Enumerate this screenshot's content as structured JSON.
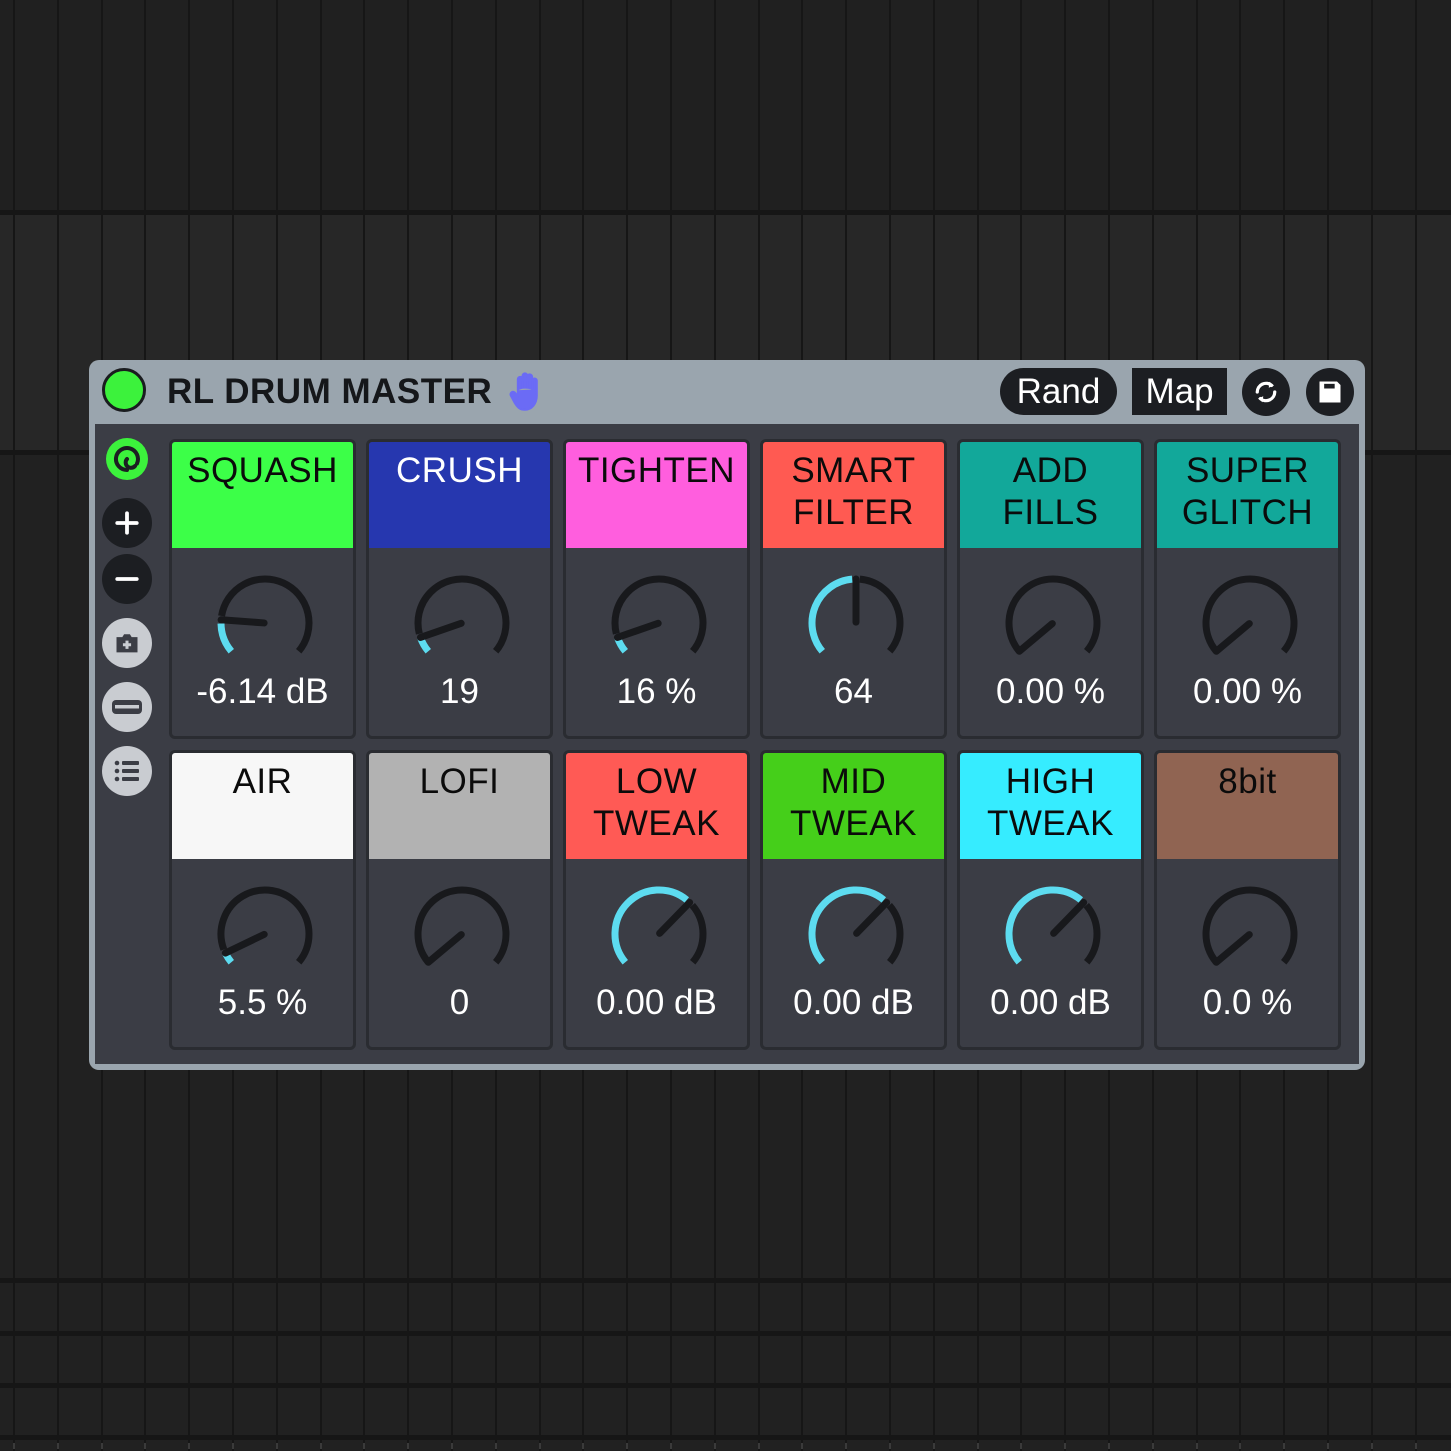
{
  "device": {
    "title": "RL DRUM MASTER",
    "power_on": true,
    "power_color": "#3cf23c",
    "hand_color": "#6b6bf5",
    "buttons": {
      "rand": "Rand",
      "map": "Map"
    },
    "icons": {
      "power": "power-toggle-icon",
      "hand": "hand-icon",
      "refresh": "refresh-icon",
      "save": "floppy-save-icon"
    }
  },
  "sidebar": [
    {
      "name": "macro-variation-toggle",
      "icon": "swirl-icon",
      "style": "active"
    },
    {
      "name": "add-macro",
      "icon": "plus-icon",
      "style": "dark"
    },
    {
      "name": "remove-macro",
      "icon": "minus-icon",
      "style": "dark"
    },
    {
      "name": "snapshot",
      "icon": "camera-plus-icon",
      "style": "light"
    },
    {
      "name": "collapse",
      "icon": "bar-icon",
      "style": "light"
    },
    {
      "name": "list",
      "icon": "list-icon",
      "style": "light"
    }
  ],
  "accent_color": "#5ddcf0",
  "macros": [
    {
      "label": "SQUASH",
      "color": "#3cff48",
      "text_color": "#0b0b0b",
      "value": "-6.14 dB",
      "position": 0.17
    },
    {
      "label": "CRUSH",
      "color": "#2637af",
      "text_color": "#ffffff",
      "value": "19",
      "position": 0.08
    },
    {
      "label": "TIGHTEN",
      "color": "#ff5ede",
      "text_color": "#0b0b0b",
      "value": "16 %",
      "position": 0.08
    },
    {
      "label": "SMART\nFILTER",
      "color": "#ff5a52",
      "text_color": "#0b0b0b",
      "value": "64",
      "position": 0.5
    },
    {
      "label": "ADD\nFILLS",
      "color": "#12a89a",
      "text_color": "#0b0b0b",
      "value": "0.00 %",
      "position": 0.0
    },
    {
      "label": "SUPER\nGLITCH",
      "color": "#12a89a",
      "text_color": "#0b0b0b",
      "value": "0.00 %",
      "position": 0.0
    },
    {
      "label": "AIR",
      "color": "#f7f7f7",
      "text_color": "#0b0b0b",
      "value": "5.5 %",
      "position": 0.055
    },
    {
      "label": "LOFI",
      "color": "#b2b2b2",
      "text_color": "#0b0b0b",
      "value": "0",
      "position": 0.0
    },
    {
      "label": "LOW\nTWEAK",
      "color": "#ff5a55",
      "text_color": "#0b0b0b",
      "value": "0.00 dB",
      "position": 0.67
    },
    {
      "label": "MID\nTWEAK",
      "color": "#45cf1a",
      "text_color": "#0b0b0b",
      "value": "0.00 dB",
      "position": 0.67
    },
    {
      "label": "HIGH\nTWEAK",
      "color": "#36ecff",
      "text_color": "#0b0b0b",
      "value": "0.00 dB",
      "position": 0.67
    },
    {
      "label": "8bit",
      "color": "#906452",
      "text_color": "#0b0b0b",
      "value": "0.0 %",
      "position": 0.0
    }
  ]
}
